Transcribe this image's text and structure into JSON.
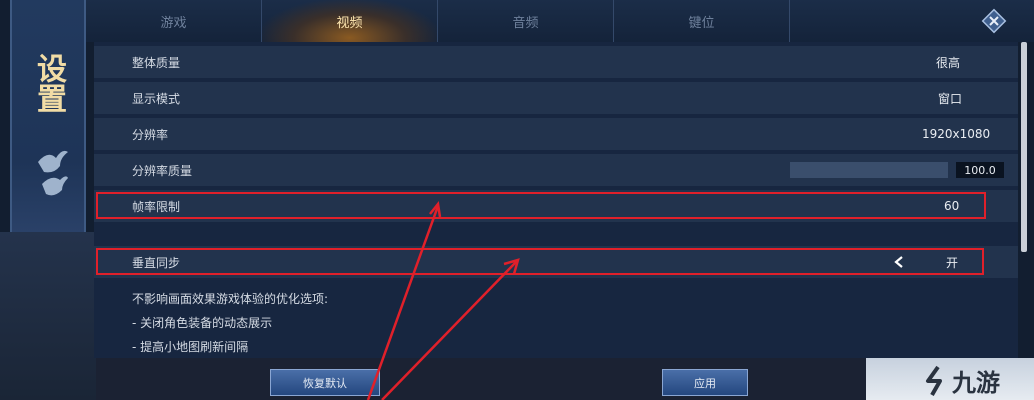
{
  "sidebar": {
    "title": "设置"
  },
  "tabs": [
    {
      "label": "游戏"
    },
    {
      "label": "视频"
    },
    {
      "label": "音频"
    },
    {
      "label": "键位"
    }
  ],
  "settings": {
    "overall_quality": {
      "label": "整体质量",
      "value": "很高"
    },
    "display_mode": {
      "label": "显示模式",
      "value": "窗口"
    },
    "resolution": {
      "label": "分辨率",
      "value": "1920x1080"
    },
    "resolution_quality": {
      "label": "分辨率质量",
      "value": "100.0"
    },
    "frame_limit": {
      "label": "帧率限制",
      "value": "60"
    },
    "vsync": {
      "label": "垂直同步",
      "value": "开"
    }
  },
  "description": {
    "heading": "不影响画面效果游戏体验的优化选项:",
    "line1": "- 关闭角色装备的动态展示",
    "line2": "- 提高小地图刷新间隔"
  },
  "buttons": {
    "restore_default": "恢复默认",
    "apply": "应用"
  },
  "watermark": {
    "text": "九游"
  },
  "colors": {
    "accent": "#ffe7b0",
    "highlight": "#e0202a"
  }
}
